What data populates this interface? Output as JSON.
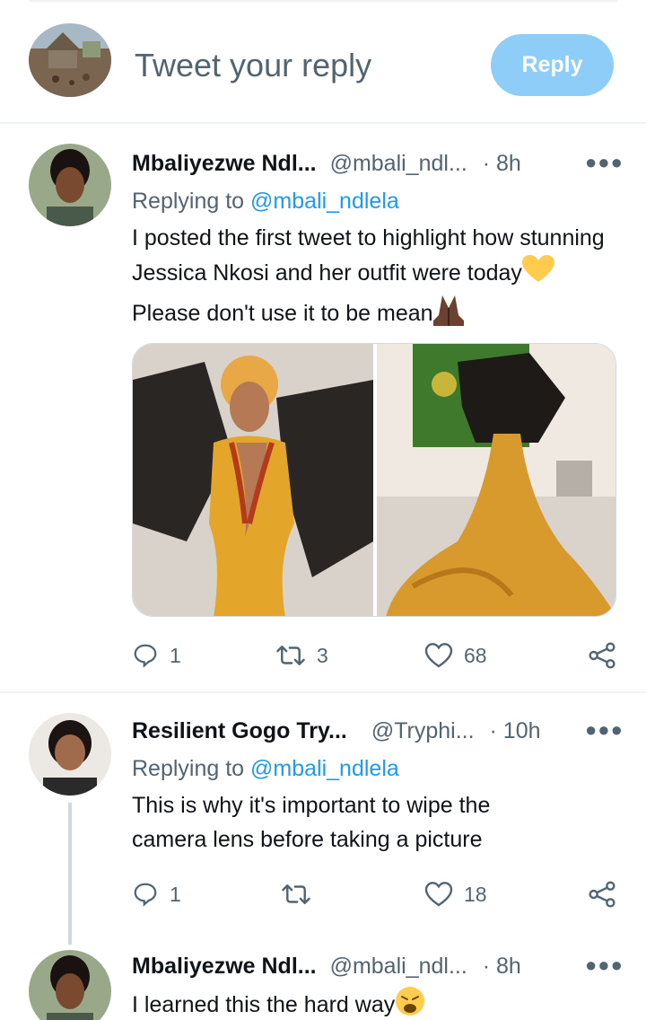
{
  "composer": {
    "placeholder": "Tweet your reply",
    "reply_label": "Reply"
  },
  "tweets": [
    {
      "name": "Mbaliyezwe Ndl...",
      "handle": "@mbali_ndl...",
      "dot": "·",
      "time": "8h",
      "replying_prefix": "Replying to",
      "replying_to": "@mbali_ndlela",
      "text_part1": "I posted the first tweet to highlight how stunning Jessica Nkosi and her outfit were today",
      "text_part2": " Please don't use it to be mean",
      "emoji_1": "yellow-heart",
      "emoji_2": "folded-hands-dark",
      "reply_count": "1",
      "retweet_count": "3",
      "like_count": "68"
    },
    {
      "name": "Resilient Gogo Try...",
      "handle": "@Tryphi...",
      "dot": "·",
      "time": "10h",
      "replying_prefix": "Replying to",
      "replying_to": "@mbali_ndlela",
      "text": "This is why it's important to wipe the camera lens before taking a picture",
      "reply_count": "1",
      "retweet_count": "",
      "like_count": "18"
    },
    {
      "name": "Mbaliyezwe Ndl...",
      "handle": "@mbali_ndl...",
      "dot": "·",
      "time": "8h",
      "text": "I learned this the hard way",
      "emoji": "weary-face"
    }
  ],
  "icons": {
    "reply": "comment-icon",
    "retweet": "retweet-icon",
    "like": "heart-icon",
    "share": "share-icon",
    "more": "more-icon"
  },
  "colors": {
    "accent": "#1d9bf0",
    "reply_button": "#8ecdf8",
    "secondary_text": "#536471"
  }
}
